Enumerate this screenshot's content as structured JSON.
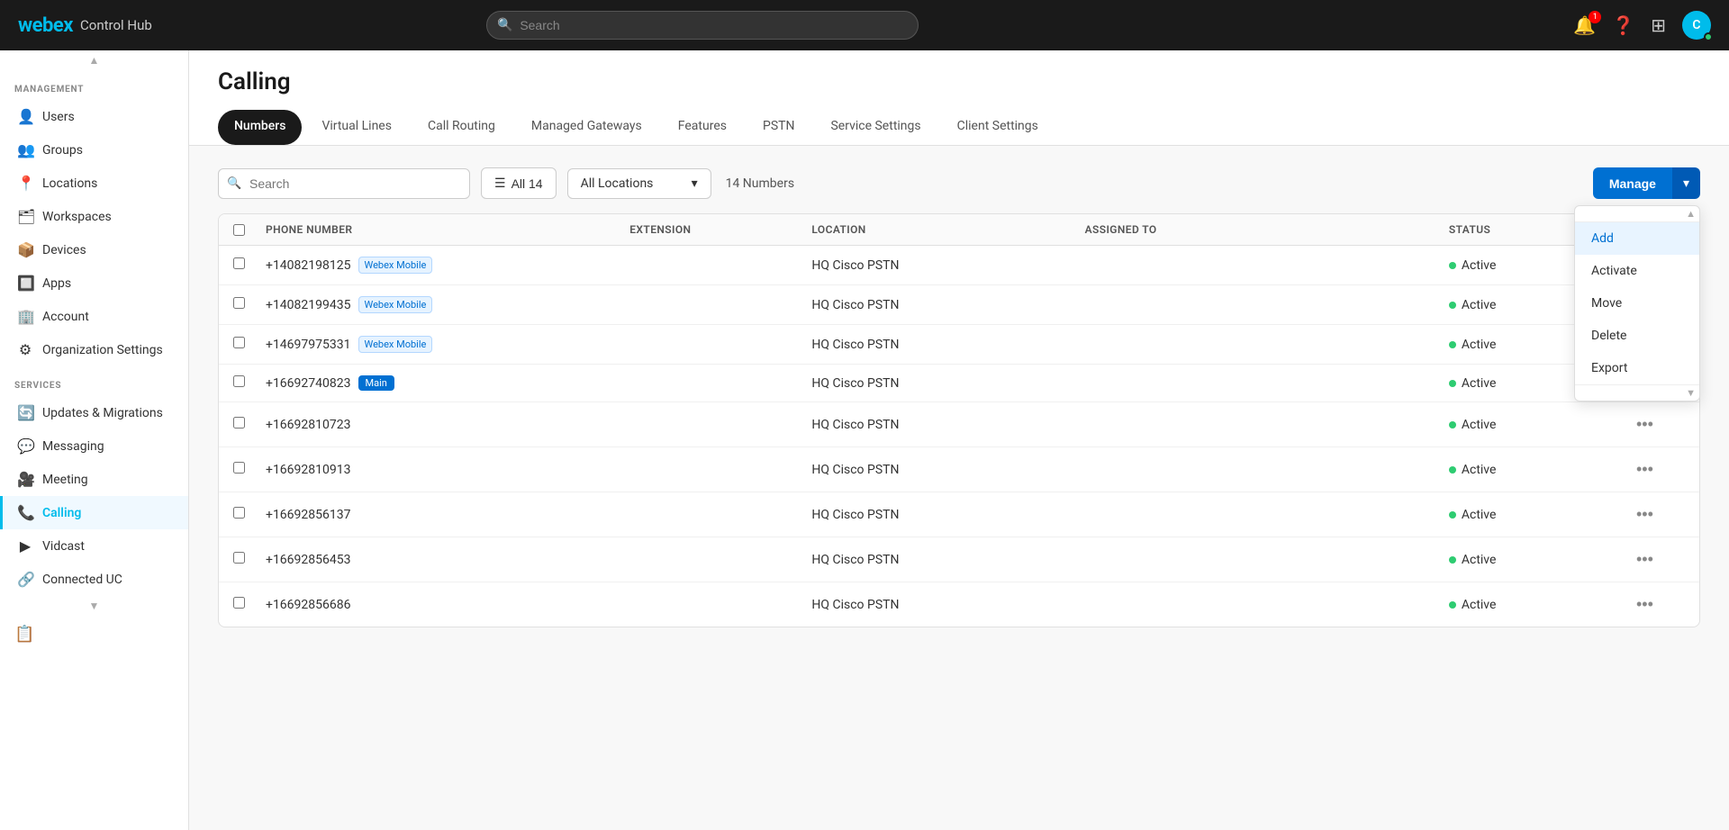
{
  "app": {
    "logo_webex": "webex",
    "logo_hub": "Control Hub"
  },
  "topnav": {
    "search_placeholder": "Search",
    "notification_count": "1",
    "avatar_initials": "C"
  },
  "sidebar": {
    "management_label": "MANAGEMENT",
    "services_label": "SERVICES",
    "management_items": [
      {
        "id": "users",
        "label": "Users",
        "icon": "👤"
      },
      {
        "id": "groups",
        "label": "Groups",
        "icon": "👥"
      },
      {
        "id": "locations",
        "label": "Locations",
        "icon": "📍"
      },
      {
        "id": "workspaces",
        "label": "Workspaces",
        "icon": "🗂"
      },
      {
        "id": "devices",
        "label": "Devices",
        "icon": "📦"
      },
      {
        "id": "apps",
        "label": "Apps",
        "icon": "🔲"
      },
      {
        "id": "account",
        "label": "Account",
        "icon": "🏢"
      },
      {
        "id": "org-settings",
        "label": "Organization Settings",
        "icon": "⚙"
      }
    ],
    "services_items": [
      {
        "id": "updates",
        "label": "Updates & Migrations",
        "icon": "🔄"
      },
      {
        "id": "messaging",
        "label": "Messaging",
        "icon": "💬"
      },
      {
        "id": "meeting",
        "label": "Meeting",
        "icon": "🎥"
      },
      {
        "id": "calling",
        "label": "Calling",
        "icon": "📞",
        "active": true
      },
      {
        "id": "vidcast",
        "label": "Vidcast",
        "icon": "▶"
      },
      {
        "id": "connected-uc",
        "label": "Connected UC",
        "icon": "🔗"
      }
    ]
  },
  "page": {
    "title": "Calling"
  },
  "tabs": [
    {
      "id": "numbers",
      "label": "Numbers",
      "active": true
    },
    {
      "id": "virtual-lines",
      "label": "Virtual Lines",
      "active": false
    },
    {
      "id": "call-routing",
      "label": "Call Routing",
      "active": false
    },
    {
      "id": "managed-gateways",
      "label": "Managed Gateways",
      "active": false
    },
    {
      "id": "features",
      "label": "Features",
      "active": false
    },
    {
      "id": "pstn",
      "label": "PSTN",
      "active": false
    },
    {
      "id": "service-settings",
      "label": "Service Settings",
      "active": false
    },
    {
      "id": "client-settings",
      "label": "Client Settings",
      "active": false
    }
  ],
  "table_controls": {
    "search_placeholder": "Search",
    "filter_label": "All 14",
    "location_label": "All Locations",
    "count_text": "14 Numbers",
    "manage_label": "Manage"
  },
  "manage_dropdown": {
    "items": [
      {
        "id": "add",
        "label": "Add",
        "highlighted": true
      },
      {
        "id": "activate",
        "label": "Activate",
        "highlighted": false
      },
      {
        "id": "move",
        "label": "Move",
        "highlighted": false
      },
      {
        "id": "delete",
        "label": "Delete",
        "highlighted": false
      },
      {
        "id": "export",
        "label": "Export",
        "highlighted": false
      }
    ]
  },
  "table": {
    "columns": [
      "",
      "Phone Number",
      "Extension",
      "Location",
      "Assigned to",
      "Status",
      ""
    ],
    "rows": [
      {
        "phone": "+14082198125",
        "tag": "Webex Mobile",
        "tag_type": "webex_mobile",
        "extension": "",
        "location": "HQ Cisco PSTN",
        "assigned_to": "",
        "status": "Active"
      },
      {
        "phone": "+14082199435",
        "tag": "Webex Mobile",
        "tag_type": "webex_mobile",
        "extension": "",
        "location": "HQ Cisco PSTN",
        "assigned_to": "",
        "status": "Active"
      },
      {
        "phone": "+14697975331",
        "tag": "Webex Mobile",
        "tag_type": "webex_mobile",
        "extension": "",
        "location": "HQ Cisco PSTN",
        "assigned_to": "",
        "status": "Active"
      },
      {
        "phone": "+16692740823",
        "tag": "Main",
        "tag_type": "main",
        "extension": "",
        "location": "HQ Cisco PSTN",
        "assigned_to": "",
        "status": "Active"
      },
      {
        "phone": "+16692810723",
        "tag": "",
        "tag_type": "",
        "extension": "",
        "location": "HQ Cisco PSTN",
        "assigned_to": "",
        "status": "Active"
      },
      {
        "phone": "+16692810913",
        "tag": "",
        "tag_type": "",
        "extension": "",
        "location": "HQ Cisco PSTN",
        "assigned_to": "",
        "status": "Active"
      },
      {
        "phone": "+16692856137",
        "tag": "",
        "tag_type": "",
        "extension": "",
        "location": "HQ Cisco PSTN",
        "assigned_to": "",
        "status": "Active"
      },
      {
        "phone": "+16692856453",
        "tag": "",
        "tag_type": "",
        "extension": "",
        "location": "HQ Cisco PSTN",
        "assigned_to": "",
        "status": "Active"
      },
      {
        "phone": "+16692856686",
        "tag": "",
        "tag_type": "",
        "extension": "",
        "location": "HQ Cisco PSTN",
        "assigned_to": "",
        "status": "Active"
      }
    ]
  }
}
